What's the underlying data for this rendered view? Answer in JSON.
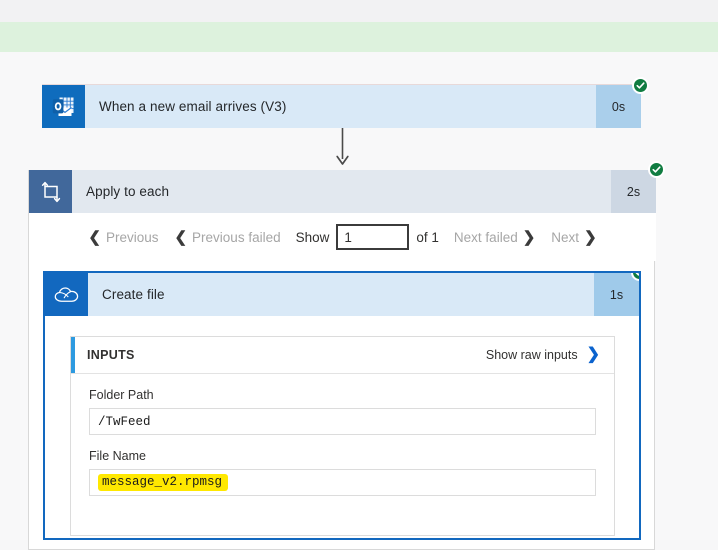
{
  "page": {
    "app": "Power Automate run history",
    "banner_color": "#ddf2dd",
    "accent_blue": "#1268bf",
    "success_green": "#107c41",
    "highlight_yellow": "#ffe800"
  },
  "trigger": {
    "icon": "outlook-icon",
    "title": "When a new email arrives (V3)",
    "duration": "0s",
    "status": "succeeded"
  },
  "loop": {
    "icon": "apply-to-each-icon",
    "title": "Apply to each",
    "duration": "2s",
    "status": "succeeded",
    "pager": {
      "previous": "Previous",
      "previous_failed": "Previous failed",
      "show_label": "Show",
      "page_value": "1",
      "of_label": "of 1",
      "next_failed": "Next failed",
      "next": "Next"
    }
  },
  "create_file": {
    "icon": "onedrive-icon",
    "title": "Create file",
    "duration": "1s",
    "status": "succeeded",
    "inputs": {
      "section_title": "INPUTS",
      "show_raw_link": "Show raw inputs",
      "fields": [
        {
          "label": "Folder Path",
          "value": "/TwFeed",
          "highlighted": false
        },
        {
          "label": "File Name",
          "value": "message_v2.rpmsg",
          "highlighted": true
        }
      ]
    }
  }
}
